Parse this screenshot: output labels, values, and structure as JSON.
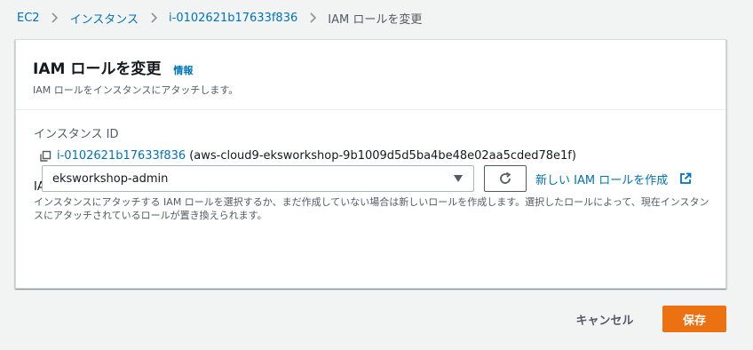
{
  "breadcrumb": {
    "items": [
      {
        "label": "EC2"
      },
      {
        "label": "インスタンス"
      },
      {
        "label": "i-0102621b17633f836"
      }
    ],
    "current": "IAM ロールを変更"
  },
  "panel": {
    "title": "IAM ロールを変更",
    "info_link": "情報",
    "description": "IAM ロールをインスタンスにアタッチします。",
    "instance_id_label": "インスタンス ID",
    "instance_id": "i-0102621b17633f836",
    "instance_name": "(aws-cloud9-eksworkshop-9b1009d5d5ba4be48e02aa5cded78e1f)",
    "iam_role_label": "IAM ロール",
    "iam_role_description": "インスタンスにアタッチする IAM ロールを選択するか、まだ作成していない場合は新しいロールを作成します。選択したロールによって、現在インスタンスにアタッチされているロールが置き換えられます。",
    "selected_role": "eksworkshop-admin",
    "create_role_link": "新しい IAM ロールを作成"
  },
  "footer": {
    "cancel_label": "キャンセル",
    "save_label": "保存"
  },
  "colors": {
    "link": "#0073bb",
    "primary_button": "#ec7211",
    "background": "#f2f3f3"
  },
  "icons": {
    "breadcrumb_separator": "chevron-right-icon",
    "copy": "copy-icon",
    "select_caret": "caret-down-icon",
    "refresh": "refresh-icon",
    "external": "external-link-icon"
  }
}
